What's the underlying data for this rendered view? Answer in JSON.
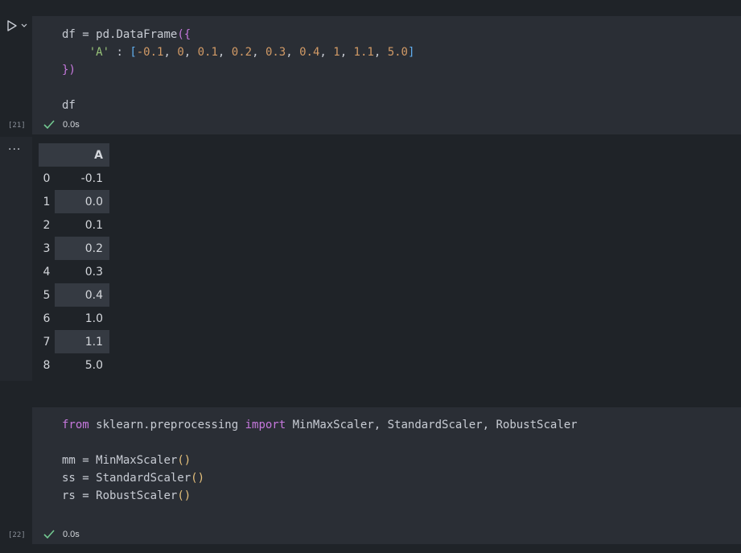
{
  "cells": [
    {
      "exec_count": "[21]",
      "status_time": "0.0s",
      "code": {
        "line1_var": "df",
        "line1_eq": " = ",
        "line1_call": "pd.DataFrame",
        "line1_open": "(",
        "line1_brace": "{",
        "line2_indent": "    ",
        "line2_key": "'A'",
        "line2_colon": " : ",
        "line2_open": "[",
        "line2_values": [
          "-0.1",
          "0",
          "0.1",
          "0.2",
          "0.3",
          "0.4",
          "1",
          "1.1",
          "5.0"
        ],
        "line2_close": "]",
        "line3_brace": "}",
        "line3_close": ")",
        "line5": "df"
      }
    },
    {
      "exec_count": "[22]",
      "status_time": "0.0s",
      "code": {
        "line1_from": "from",
        "line1_module": " sklearn.preprocessing ",
        "line1_import": "import",
        "line1_names": " MinMaxScaler, StandardScaler, RobustScaler",
        "line3_var": "mm",
        "line3_eq": " = ",
        "line3_call": "MinMaxScaler",
        "line4_var": "ss",
        "line4_eq": " = ",
        "line4_call": "StandardScaler",
        "line5_var": "rs",
        "line5_eq": " = ",
        "line5_call": "RobustScaler",
        "parens": "()"
      }
    }
  ],
  "output": {
    "more_label": "···",
    "column": "A",
    "rows": [
      {
        "index": "0",
        "value": "-0.1"
      },
      {
        "index": "1",
        "value": "0.0"
      },
      {
        "index": "2",
        "value": "0.1"
      },
      {
        "index": "3",
        "value": "0.2"
      },
      {
        "index": "4",
        "value": "0.3"
      },
      {
        "index": "5",
        "value": "0.4"
      },
      {
        "index": "6",
        "value": "1.0"
      },
      {
        "index": "7",
        "value": "1.1"
      },
      {
        "index": "8",
        "value": "5.0"
      }
    ]
  },
  "colors": {
    "background": "#1f2328",
    "editor": "#2a2e35",
    "keyword": "#c678dd",
    "string": "#98c379",
    "number": "#d19a66",
    "check": "#73c991"
  },
  "icons": {
    "run": "play-icon",
    "run_menu": "chevron-down-icon",
    "success": "check-icon",
    "more": "ellipsis-icon"
  }
}
